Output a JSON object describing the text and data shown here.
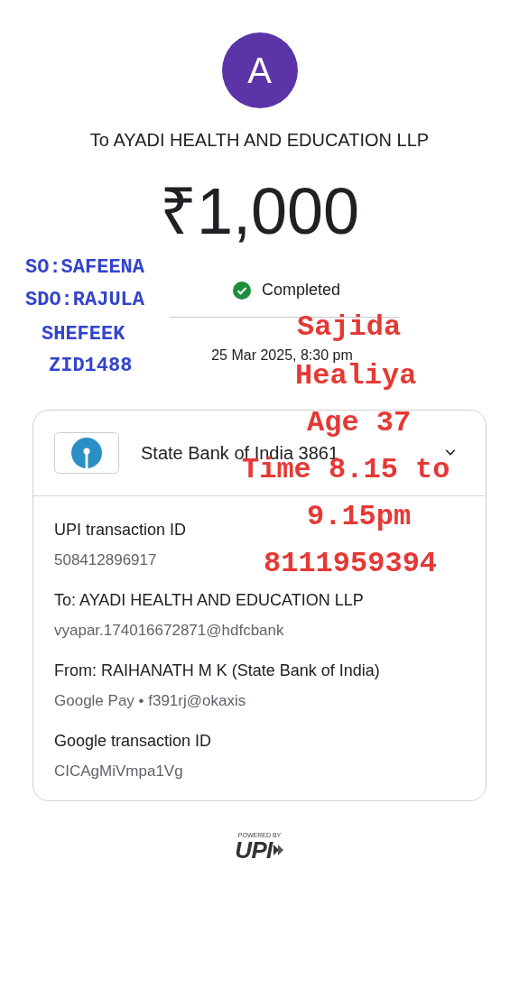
{
  "avatar": {
    "letter": "A"
  },
  "recipient_title": "To AYADI HEALTH AND EDUCATION LLP",
  "amount": "₹1,000",
  "status": {
    "label": "Completed",
    "completed": true
  },
  "datetime": "25 Mar 2025, 8:30 pm",
  "account": {
    "bank": "State Bank of India 3861",
    "expanded": false
  },
  "details": [
    {
      "label": "UPI transaction ID",
      "value": "508412896917"
    },
    {
      "label": "To: AYADI HEALTH AND EDUCATION LLP",
      "value": "vyapar.174016672871@hdfcbank"
    },
    {
      "label": "From: RAIHANATH  M K (State Bank of India)",
      "value": "Google Pay • f391rj@okaxis"
    },
    {
      "label": "Google transaction ID",
      "value": "CICAgMiVmpa1Vg"
    }
  ],
  "footer": {
    "powered_by": "POWERED BY",
    "brand": "UPI"
  },
  "annotations": [
    {
      "text": "SO:SAFEENA",
      "color": "#3344cc"
    },
    {
      "text": "SDO:RAJULA",
      "color": "#3344cc"
    },
    {
      "text": "SHEFEEK",
      "color": "#3344cc"
    },
    {
      "text": "ZID1488",
      "color": "#3344cc"
    },
    {
      "text": "Sajida",
      "color": "#e53935"
    },
    {
      "text": "Healiya",
      "color": "#e53935"
    },
    {
      "text": "Age 37",
      "color": "#e53935"
    },
    {
      "text": "Time 8.15 to",
      "color": "#e53935"
    },
    {
      "text": "9.15pm",
      "color": "#e53935"
    },
    {
      "text": "8111959394",
      "color": "#e53935"
    }
  ]
}
